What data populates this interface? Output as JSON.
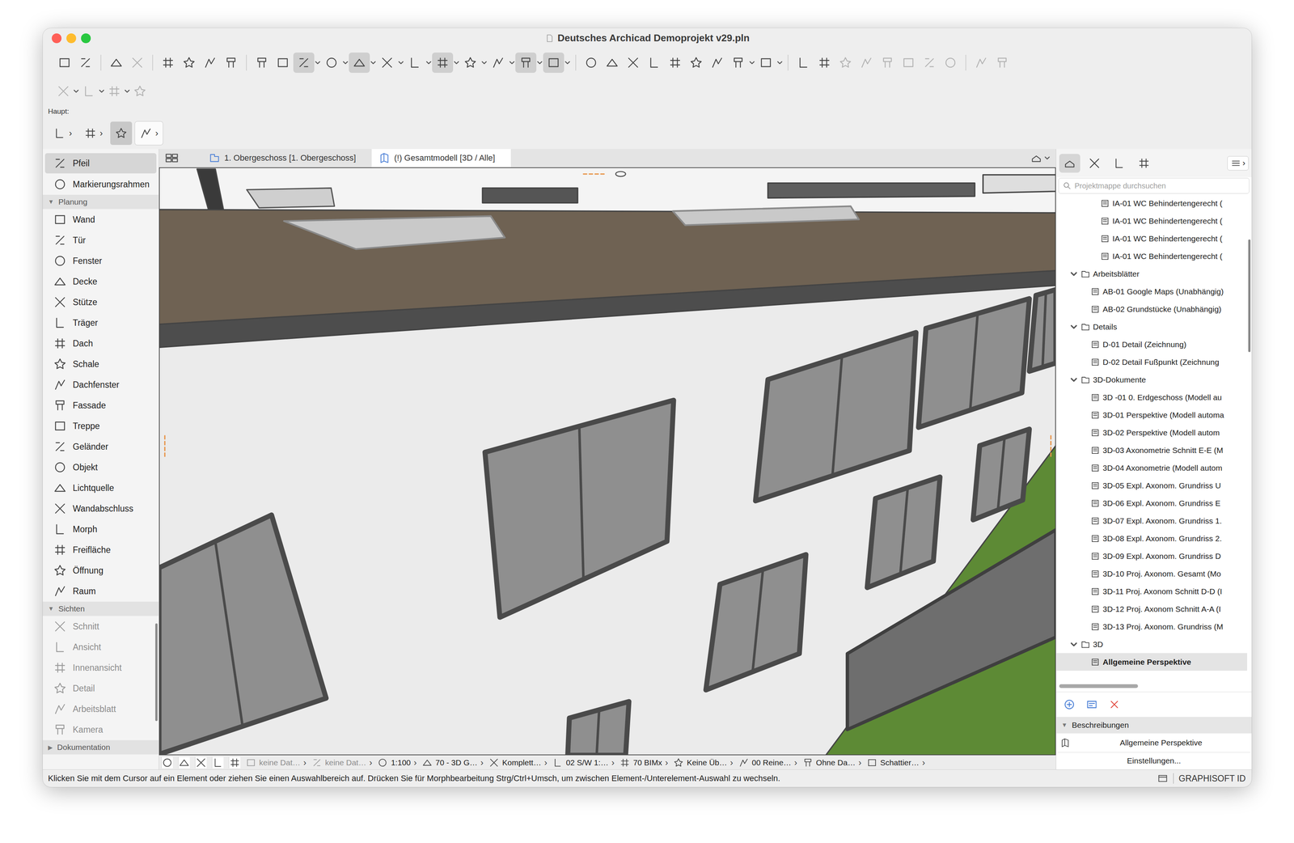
{
  "window": {
    "title": "Deutsches Archicad Demoprojekt v29.pln"
  },
  "toolbar_main": [
    [
      {
        "pressed": false,
        "dropdown": false,
        "disabled": false
      },
      {
        "pressed": false,
        "dropdown": false,
        "disabled": false
      }
    ],
    [
      {
        "pressed": false,
        "dropdown": false,
        "disabled": false
      },
      {
        "pressed": false,
        "dropdown": false,
        "disabled": true
      }
    ],
    [
      {
        "pressed": false,
        "dropdown": false,
        "disabled": false
      },
      {
        "pressed": false,
        "dropdown": false,
        "disabled": false
      },
      {
        "pressed": false,
        "dropdown": false,
        "disabled": false
      },
      {
        "pressed": false,
        "dropdown": false,
        "disabled": false
      }
    ],
    [
      {
        "pressed": false,
        "dropdown": false,
        "disabled": false
      },
      {
        "pressed": false,
        "dropdown": false,
        "disabled": false
      },
      {
        "pressed": true,
        "dropdown": true,
        "disabled": false
      },
      {
        "pressed": false,
        "dropdown": true,
        "disabled": false
      },
      {
        "pressed": true,
        "dropdown": true,
        "disabled": false
      },
      {
        "pressed": false,
        "dropdown": true,
        "disabled": false
      },
      {
        "pressed": false,
        "dropdown": true,
        "disabled": false
      },
      {
        "pressed": true,
        "dropdown": true,
        "disabled": false
      },
      {
        "pressed": false,
        "dropdown": true,
        "disabled": false
      },
      {
        "pressed": false,
        "dropdown": true,
        "disabled": false
      },
      {
        "pressed": true,
        "dropdown": true,
        "disabled": false
      },
      {
        "pressed": true,
        "dropdown": true,
        "disabled": false
      }
    ],
    [
      {
        "pressed": false,
        "dropdown": false,
        "disabled": false
      },
      {
        "pressed": false,
        "dropdown": false,
        "disabled": false
      },
      {
        "pressed": false,
        "dropdown": false,
        "disabled": false
      },
      {
        "pressed": false,
        "dropdown": false,
        "disabled": false
      },
      {
        "pressed": false,
        "dropdown": false,
        "disabled": false
      },
      {
        "pressed": false,
        "dropdown": false,
        "disabled": false
      },
      {
        "pressed": false,
        "dropdown": false,
        "disabled": false
      },
      {
        "pressed": false,
        "dropdown": true,
        "disabled": false
      },
      {
        "pressed": false,
        "dropdown": true,
        "disabled": false
      }
    ],
    [
      {
        "pressed": false,
        "dropdown": false,
        "disabled": false
      },
      {
        "pressed": false,
        "dropdown": false,
        "disabled": false
      },
      {
        "pressed": false,
        "dropdown": false,
        "disabled": true
      },
      {
        "pressed": false,
        "dropdown": false,
        "disabled": true
      },
      {
        "pressed": false,
        "dropdown": false,
        "disabled": true
      },
      {
        "pressed": false,
        "dropdown": false,
        "disabled": true
      },
      {
        "pressed": false,
        "dropdown": false,
        "disabled": true
      },
      {
        "pressed": false,
        "dropdown": false,
        "disabled": true
      }
    ],
    [
      {
        "pressed": false,
        "dropdown": false,
        "disabled": true
      },
      {
        "pressed": false,
        "dropdown": false,
        "disabled": true
      }
    ]
  ],
  "toolbar_secondary": [
    [
      {
        "pressed": false,
        "dropdown": true,
        "disabled": true
      },
      {
        "pressed": false,
        "dropdown": true,
        "disabled": true
      },
      {
        "pressed": false,
        "dropdown": true,
        "disabled": true
      },
      {
        "pressed": false,
        "dropdown": false,
        "disabled": true
      }
    ]
  ],
  "info_box": {
    "label": "Haupt:",
    "items": [
      {
        "arrow": "›",
        "pressed": false,
        "boxed": false
      },
      {
        "arrow": "›",
        "pressed": false,
        "boxed": false
      },
      {
        "arrow": "",
        "pressed": true,
        "boxed": false
      },
      {
        "arrow": "›",
        "pressed": false,
        "boxed": true
      }
    ]
  },
  "toolbox": {
    "top_items": [
      {
        "label": "Pfeil",
        "selected": true,
        "disabled": false
      },
      {
        "label": "Markierungsrahmen",
        "selected": false,
        "disabled": false
      }
    ],
    "sections": [
      {
        "title": "Planung",
        "marker": "▼",
        "expanded": true,
        "items": [
          {
            "label": "Wand",
            "selected": false,
            "disabled": false
          },
          {
            "label": "Tür",
            "selected": false,
            "disabled": false
          },
          {
            "label": "Fenster",
            "selected": false,
            "disabled": false
          },
          {
            "label": "Decke",
            "selected": false,
            "disabled": false
          },
          {
            "label": "Stütze",
            "selected": false,
            "disabled": false
          },
          {
            "label": "Träger",
            "selected": false,
            "disabled": false
          },
          {
            "label": "Dach",
            "selected": false,
            "disabled": false
          },
          {
            "label": "Schale",
            "selected": false,
            "disabled": false
          },
          {
            "label": "Dachfenster",
            "selected": false,
            "disabled": false
          },
          {
            "label": "Fassade",
            "selected": false,
            "disabled": false
          },
          {
            "label": "Treppe",
            "selected": false,
            "disabled": false
          },
          {
            "label": "Geländer",
            "selected": false,
            "disabled": false
          },
          {
            "label": "Objekt",
            "selected": false,
            "disabled": false
          },
          {
            "label": "Lichtquelle",
            "selected": false,
            "disabled": false
          },
          {
            "label": "Wandabschluss",
            "selected": false,
            "disabled": false
          },
          {
            "label": "Morph",
            "selected": false,
            "disabled": false
          },
          {
            "label": "Freifläche",
            "selected": false,
            "disabled": false
          },
          {
            "label": "Öffnung",
            "selected": false,
            "disabled": false
          },
          {
            "label": "Raum",
            "selected": false,
            "disabled": false
          }
        ]
      },
      {
        "title": "Sichten",
        "marker": "▼",
        "expanded": true,
        "items": [
          {
            "label": "Schnitt",
            "selected": false,
            "disabled": true
          },
          {
            "label": "Ansicht",
            "selected": false,
            "disabled": true
          },
          {
            "label": "Innenansicht",
            "selected": false,
            "disabled": true
          },
          {
            "label": "Detail",
            "selected": false,
            "disabled": true
          },
          {
            "label": "Arbeitsblatt",
            "selected": false,
            "disabled": true
          },
          {
            "label": "Kamera",
            "selected": false,
            "disabled": true
          }
        ]
      },
      {
        "title": "Dokumentation",
        "marker": "▶",
        "expanded": false,
        "items": []
      }
    ]
  },
  "view_tabs": [
    {
      "label": "1. Obergeschoss [1. Obergeschoss]",
      "selected": false
    },
    {
      "label": "(!) Gesamtmodell [3D / Alle]",
      "selected": true
    }
  ],
  "view_status": [
    {
      "label": "keine Dat…",
      "disabled": true,
      "chevron": "›"
    },
    {
      "label": "keine Dat…",
      "disabled": true,
      "chevron": "›"
    },
    {
      "label": "1:100",
      "disabled": false,
      "chevron": "›"
    },
    {
      "label": "70 - 3D G…",
      "disabled": false,
      "chevron": "›"
    },
    {
      "label": "Komplett…",
      "disabled": false,
      "chevron": "›"
    },
    {
      "label": "02 S/W 1:…",
      "disabled": false,
      "chevron": "›"
    },
    {
      "label": "70 BIMx",
      "disabled": false,
      "chevron": "›"
    },
    {
      "label": "Keine Üb…",
      "disabled": false,
      "chevron": "›"
    },
    {
      "label": "00 Reine…",
      "disabled": false,
      "chevron": "›"
    },
    {
      "label": "Ohne Da…",
      "disabled": false,
      "chevron": "›"
    },
    {
      "label": "Schattier…",
      "disabled": false,
      "chevron": "›"
    }
  ],
  "navigator": {
    "tabs": [
      {
        "selected": true
      },
      {
        "selected": false
      },
      {
        "selected": false
      },
      {
        "selected": false
      }
    ],
    "menu_arrow": "›",
    "search": {
      "placeholder": "Projektmappe durchsuchen"
    },
    "tree": [
      {
        "label": "IA-01 WC Behindertengerecht (",
        "depth": 3,
        "kind": "item",
        "selected": false
      },
      {
        "label": "IA-01 WC Behindertengerecht (",
        "depth": 3,
        "kind": "item",
        "selected": false
      },
      {
        "label": "IA-01 WC Behindertengerecht (",
        "depth": 3,
        "kind": "item",
        "selected": false
      },
      {
        "label": "IA-01 WC Behindertengerecht (",
        "depth": 3,
        "kind": "item",
        "selected": false
      },
      {
        "label": "Arbeitsblätter",
        "depth": 1,
        "kind": "folder",
        "expanded": true,
        "selected": false
      },
      {
        "label": "AB-01 Google Maps (Unabhängig)",
        "depth": 2,
        "kind": "item",
        "selected": false
      },
      {
        "label": "AB-02 Grundstücke (Unabhängig)",
        "depth": 2,
        "kind": "item",
        "selected": false
      },
      {
        "label": "Details",
        "depth": 1,
        "kind": "folder",
        "expanded": true,
        "selected": false
      },
      {
        "label": "D-01 Detail (Zeichnung)",
        "depth": 2,
        "kind": "item",
        "selected": false
      },
      {
        "label": "D-02 Detail Fußpunkt (Zeichnung",
        "depth": 2,
        "kind": "item",
        "selected": false
      },
      {
        "label": "3D-Dokumente",
        "depth": 1,
        "kind": "folder",
        "expanded": true,
        "selected": false
      },
      {
        "label": "3D -01 0. Erdgeschoss (Modell au",
        "depth": 2,
        "kind": "item",
        "selected": false
      },
      {
        "label": "3D-01 Perspektive (Modell automa",
        "depth": 2,
        "kind": "item",
        "selected": false
      },
      {
        "label": "3D-02 Perspektive (Modell autom",
        "depth": 2,
        "kind": "item",
        "selected": false
      },
      {
        "label": "3D-03 Axonometrie Schnitt E-E (M",
        "depth": 2,
        "kind": "item",
        "selected": false
      },
      {
        "label": "3D-04 Axonometrie (Modell autom",
        "depth": 2,
        "kind": "item",
        "selected": false
      },
      {
        "label": "3D-05 Expl. Axonom. Grundriss U",
        "depth": 2,
        "kind": "item",
        "selected": false
      },
      {
        "label": "3D-06 Expl. Axonom. Grundriss E",
        "depth": 2,
        "kind": "item",
        "selected": false
      },
      {
        "label": "3D-07 Expl. Axonom. Grundriss 1.",
        "depth": 2,
        "kind": "item",
        "selected": false
      },
      {
        "label": "3D-08 Expl. Axonom. Grundriss 2.",
        "depth": 2,
        "kind": "item",
        "selected": false
      },
      {
        "label": "3D-09 Expl. Axonom. Grundriss D",
        "depth": 2,
        "kind": "item",
        "selected": false
      },
      {
        "label": "3D-10 Proj. Axonom. Gesamt (Mo",
        "depth": 2,
        "kind": "item",
        "selected": false
      },
      {
        "label": "3D-11 Proj. Axonom Schnitt D-D (I",
        "depth": 2,
        "kind": "item",
        "selected": false
      },
      {
        "label": "3D-12 Proj. Axonom Schnitt A-A (I",
        "depth": 2,
        "kind": "item",
        "selected": false
      },
      {
        "label": "3D-13 Proj. Axonom. Grundriss (M",
        "depth": 2,
        "kind": "item",
        "selected": false
      },
      {
        "label": "3D",
        "depth": 1,
        "kind": "folder",
        "expanded": true,
        "selected": false
      },
      {
        "label": "Allgemeine Perspektive",
        "depth": 2,
        "kind": "item",
        "selected": true
      }
    ],
    "descriptions": {
      "marker": "▼",
      "title": "Beschreibungen",
      "value": "Allgemeine Perspektive",
      "button": "Einstellungen..."
    }
  },
  "status_bar": {
    "message": "Klicken Sie mit dem Cursor auf ein Element oder ziehen Sie einen Auswahlbereich auf. Drücken Sie für Morphbearbeitung Strg/Ctrl+Umsch, um zwischen Element-/Unterelement-Auswahl zu wechseln.",
    "account": "GRAPHISOFT ID"
  }
}
